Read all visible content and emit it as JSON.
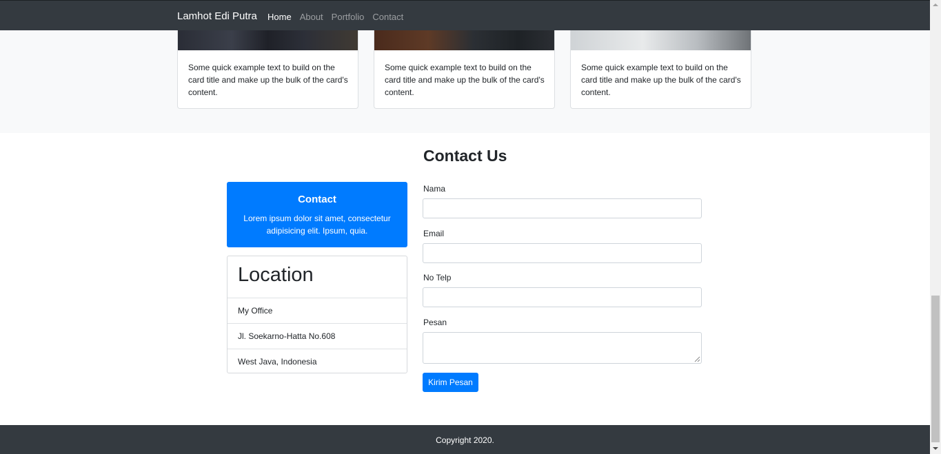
{
  "navbar": {
    "brand": "Lamhot Edi Putra",
    "links": [
      {
        "label": "Home",
        "active": true
      },
      {
        "label": "About",
        "active": false
      },
      {
        "label": "Portfolio",
        "active": false
      },
      {
        "label": "Contact",
        "active": false
      }
    ]
  },
  "cards": [
    {
      "text": "Some quick example text to build on the card title and make up the bulk of the card's content."
    },
    {
      "text": "Some quick example text to build on the card title and make up the bulk of the card's content."
    },
    {
      "text": "Some quick example text to build on the card title and make up the bulk of the card's content."
    }
  ],
  "contact": {
    "section_title": "Contact Us",
    "box_title": "Contact",
    "box_text": "Lorem ipsum dolor sit amet, consectetur adipisicing elit. Ipsum, quia.",
    "location_title": "Location",
    "location_items": [
      "My Office",
      "Jl. Soekarno-Hatta No.608",
      "West Java, Indonesia"
    ]
  },
  "form": {
    "fields": [
      {
        "label": "Nama",
        "value": ""
      },
      {
        "label": "Email",
        "value": ""
      },
      {
        "label": "No Telp",
        "value": ""
      },
      {
        "label": "Pesan",
        "value": ""
      }
    ],
    "submit_label": "Kirim Pesan"
  },
  "footer": {
    "text": "Copyright 2020."
  },
  "colors": {
    "navbar_bg": "#343a40",
    "primary": "#007bff",
    "section_bg": "#f8f9fa"
  }
}
